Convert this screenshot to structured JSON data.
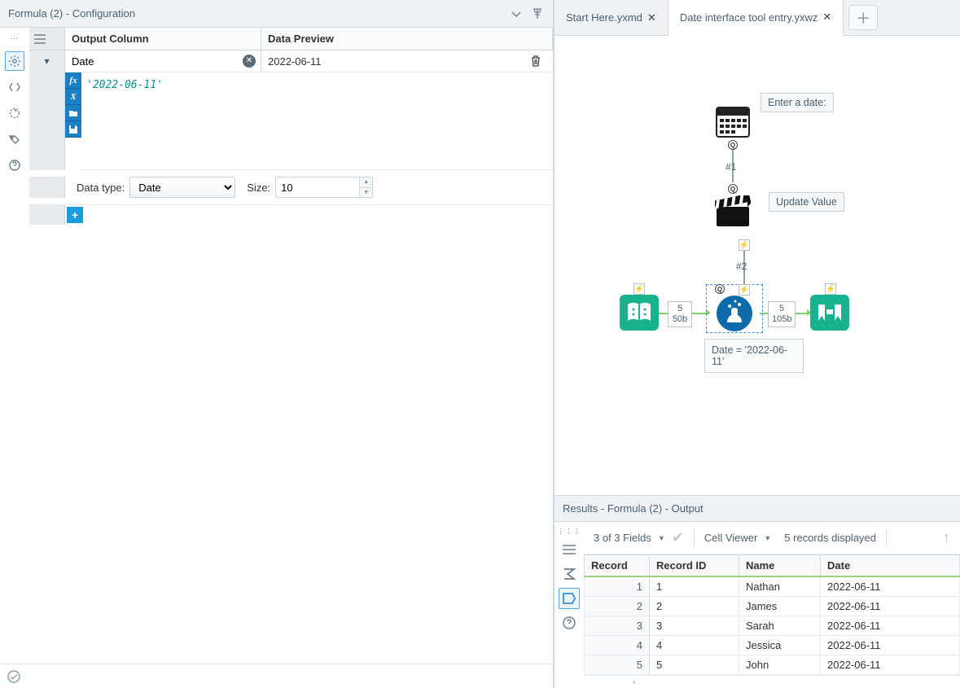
{
  "config": {
    "title": "Formula (2) - Configuration",
    "output_column_header": "Output Column",
    "data_preview_header": "Data Preview",
    "field_name": "Date",
    "preview_value": "2022-06-11",
    "expression": "'2022-06-11'",
    "data_type_label": "Data type:",
    "data_type_value": "Date",
    "size_label": "Size:",
    "size_value": "10"
  },
  "tabs": [
    {
      "label": "Start Here.yxmd",
      "active": false
    },
    {
      "label": "Date interface tool entry.yxwz",
      "active": true
    }
  ],
  "canvas": {
    "enter_date_label": "Enter a date:",
    "conn1": "#1",
    "update_value_label": "Update Value",
    "conn2": "#2",
    "in_badge_top": "5",
    "in_badge_bottom": "50b",
    "out_badge_top": "5",
    "out_badge_bottom": "105b",
    "formula_annotation": "Date = '2022-06-11'"
  },
  "results": {
    "title": "Results - Formula (2) - Output",
    "fields_text": "3 of 3 Fields",
    "cell_viewer": "Cell Viewer",
    "records_text": "5 records displayed",
    "columns": [
      "Record",
      "Record ID",
      "Name",
      "Date"
    ],
    "rows": [
      {
        "n": "1",
        "record_id": "1",
        "name": "Nathan",
        "date": "2022-06-11"
      },
      {
        "n": "2",
        "record_id": "2",
        "name": "James",
        "date": "2022-06-11"
      },
      {
        "n": "3",
        "record_id": "3",
        "name": "Sarah",
        "date": "2022-06-11"
      },
      {
        "n": "4",
        "record_id": "4",
        "name": "Jessica",
        "date": "2022-06-11"
      },
      {
        "n": "5",
        "record_id": "5",
        "name": "John",
        "date": "2022-06-11"
      }
    ]
  }
}
